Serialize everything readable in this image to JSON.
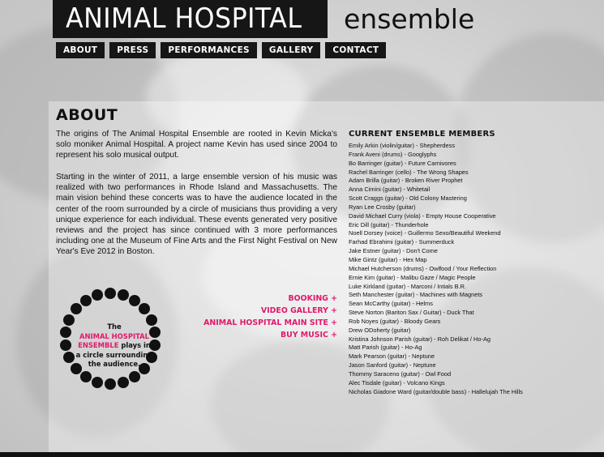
{
  "header": {
    "title_main": "ANIMAL HOSPITAL",
    "title_sub": "ensemble"
  },
  "nav": {
    "items": [
      {
        "label": "ABOUT"
      },
      {
        "label": "PRESS"
      },
      {
        "label": "PERFORMANCES"
      },
      {
        "label": "GALLERY"
      },
      {
        "label": "CONTACT"
      }
    ]
  },
  "about": {
    "heading": "ABOUT",
    "paragraphs": [
      "The origins of The Animal Hospital Ensemble are rooted in Kevin Micka's solo moniker Animal Hospital. A project name Kevin has used since 2004 to represent his solo musical output.",
      "Starting in the winter of 2011, a large ensemble version of his music was realized with two performances in Rhode Island and Massachusetts. The main vision behind these concerts was to have the audience located in the center of the room surrounded by a circle of musicians thus providing a very unique experience for each individual. These events generated very positive reviews and the project has since continued with 3 more performances including one at the Museum of Fine Arts and the First Night Festival on New Year's Eve 2012 in Boston."
    ]
  },
  "circle_caption": {
    "part1": "The",
    "highlight": "ANIMAL HOSPITAL ENSEMBLE",
    "part2": "plays in a circle surrounding the audience."
  },
  "links": [
    {
      "label": "BOOKING +"
    },
    {
      "label": "VIDEO GALLERY +"
    },
    {
      "label": "ANIMAL HOSPITAL MAIN SITE +"
    },
    {
      "label": "BUY MUSIC +"
    }
  ],
  "members": {
    "heading": "CURRENT ENSEMBLE MEMBERS",
    "list": [
      "Emily Arkin (violin/guitar) - Shepherdess",
      "Frank Aveni (drums) - Googlyphs",
      "Bo Barringer (guitar) - Future Carnivores",
      "Rachel Barringer (cello) - The Wrong Shapes",
      "Adam Brilla (guitar) - Broken River Prophet",
      "Anna Cimini (guitar) - Whitetail",
      "Scott Craggs (guitar) - Old Colony Mastering",
      "Ryan Lee Crosby (guitar)",
      "David Michael Curry (viola) - Empty House Cooperative",
      "Eric Dill (guitar) - Thunderhole",
      "Noell Dorsey (voice) - Guillermo Sexo/Beautiful Weekend",
      "Farhad Ebrahimi (guitar) - Summerduck",
      "Jake Estner (guitar) - Don't Come",
      "Mike Gintz (guitar) - Hex Map",
      "Michael Hutcherson (drums) - Owlfood / Your Reflection",
      "Ernie Kim (guitar) - Malibu Gaze / Magic People",
      "Luke Kirkland (guitar) - Marconi / Intials B.R.",
      "Seth Manchester (guitar) - Machines with Magnets",
      "Sean McCarthy (guitar) - Helms",
      "Steve Norton (Bariton Sax / Guitar) - Duck That",
      "Rob Noyes (guitar) - Bloody Gears",
      "Drew ODoherty (guitar)",
      "Kristina Johnson Parish (guitar) - Roh Delikat / Ho-Ag",
      "Matt Parish (guitar) - Ho-Ag",
      "Mark Pearson (guitar) - Neptune",
      "Jason Sanford (guitar) - Neptune",
      "Thommy Saraceno (guitar) - Owl Food",
      "Alec Tisdale (guitar) - Volcano Kings",
      "Nicholas Giadone Ward (guitar/double bass) - Hallelujah The Hills"
    ]
  },
  "colors": {
    "accent": "#e0196c",
    "dark": "#161616"
  }
}
